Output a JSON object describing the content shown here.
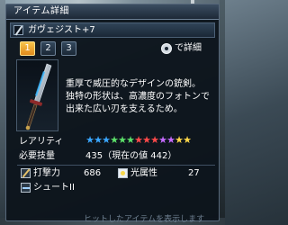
{
  "window": {
    "title": "アイテム詳細"
  },
  "item": {
    "name": "ガヴェジスト+7"
  },
  "tabs": [
    {
      "label": "1",
      "active": true
    },
    {
      "label": "2",
      "active": false
    },
    {
      "label": "3",
      "active": false
    }
  ],
  "detail_hint": {
    "icon": "button-glyph-icon",
    "label": "で詳細"
  },
  "weapon_image": {
    "icon": "weapon-sword-icon"
  },
  "description": [
    "重厚で威圧的なデザインの銃剣。",
    "独特の形状は、高濃度のフォトンで",
    "出来た広い刃を支えるため。"
  ],
  "rarity": {
    "label": "レアリティ",
    "max_stars": 13,
    "stars": 13,
    "star_colors": [
      "#3aa7ff",
      "#3aa7ff",
      "#3aa7ff",
      "#5ce06a",
      "#5ce06a",
      "#5ce06a",
      "#ff4a4a",
      "#ff4a4a",
      "#ff4a4a",
      "#c66bff",
      "#c66bff",
      "#ffd84a",
      "#ffd84a"
    ]
  },
  "requirement": {
    "label": "必要技量",
    "value": "435（現在の値 442）"
  },
  "stats": {
    "strike": {
      "label": "打撃力",
      "value": "686",
      "icon": "strike-icon"
    },
    "element": {
      "label": "光属性",
      "value": "27",
      "icon": "light-element-icon"
    },
    "type": {
      "label": "シュートII",
      "icon": "shoot-icon"
    }
  },
  "footer_faded": "ヒットしたアイテムを表示します"
}
